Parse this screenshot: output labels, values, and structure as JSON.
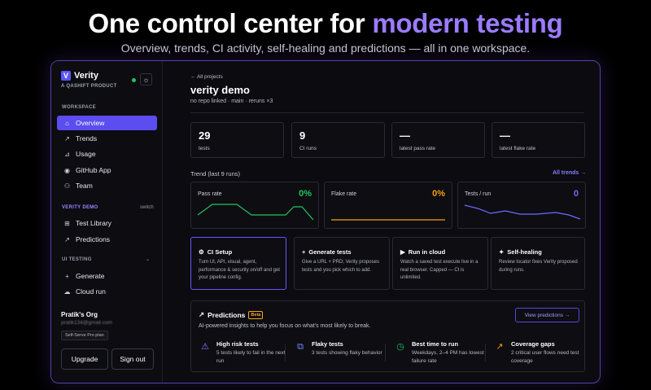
{
  "hero": {
    "title_main": "One control center for ",
    "title_accent": "modern testing",
    "subtitle": "Overview, trends, CI activity, self-healing and predictions — all in one workspace."
  },
  "sidebar": {
    "brand_name": "Verity",
    "brand_tag": "A QASHIFT PRODUCT",
    "workspace_label": "WORKSPACE",
    "workspace_items": [
      {
        "label": "Overview",
        "icon": "home-icon"
      },
      {
        "label": "Trends",
        "icon": "trend-icon"
      },
      {
        "label": "Usage",
        "icon": "chart-icon"
      },
      {
        "label": "GitHub App",
        "icon": "github-icon"
      },
      {
        "label": "Team",
        "icon": "team-icon"
      }
    ],
    "project_label": "VERITY DEMO",
    "project_switch": "switch",
    "project_items": [
      {
        "label": "Test Library",
        "icon": "grid-icon"
      },
      {
        "label": "Predictions",
        "icon": "trend-icon"
      }
    ],
    "testing_label": "UI TESTING",
    "testing_items": [
      {
        "label": "Generate",
        "icon": "plus-icon"
      },
      {
        "label": "Cloud run",
        "icon": "cloud-icon"
      }
    ],
    "org_name": "Pratik's Org",
    "org_email": "pratik134@gmail.com",
    "plan": "Self-Serve Pro plan",
    "upgrade_label": "Upgrade",
    "signout_label": "Sign out"
  },
  "main": {
    "back_link": "← All projects",
    "project_title": "verity demo",
    "project_meta": "no repo linked · main · reruns ×3",
    "stats": [
      {
        "value": "29",
        "label": "tests"
      },
      {
        "value": "9",
        "label": "CI runs"
      },
      {
        "value": "—",
        "label": "latest pass rate"
      },
      {
        "value": "—",
        "label": "latest flake rate"
      }
    ],
    "trend_label": "Trend (last 9 runs)",
    "trend_link": "All trends →",
    "trends": [
      {
        "title": "Pass rate",
        "value": "0%",
        "color": "#22c55e"
      },
      {
        "title": "Flake rate",
        "value": "0%",
        "color": "#f59e0b"
      },
      {
        "title": "Tests / run",
        "value": "0",
        "color": "#6d6bff"
      }
    ],
    "features": [
      {
        "title": "CI Setup",
        "icon": "gear-icon",
        "body": "Turn UI, API, visual, agent, performance & security on/off and get your pipeline config."
      },
      {
        "title": "Generate tests",
        "icon": "plus-icon",
        "body": "Give a URL + PRD; Verity proposes tests and you pick which to add."
      },
      {
        "title": "Run in cloud",
        "icon": "play-icon",
        "body": "Watch a saved test execute live in a real browser. Capped — CI is unlimited."
      },
      {
        "title": "Self-healing",
        "icon": "wand-icon",
        "body": "Review locator fixes Verity proposed during runs."
      }
    ],
    "predictions": {
      "title": "Predictions",
      "badge": "Beta",
      "subtitle": "AI-powered insights to help you focus on what's most likely to break.",
      "button": "View predictions →",
      "items": [
        {
          "title": "High risk tests",
          "desc": "5 tests likely to fail in the next run",
          "icon": "warning-icon",
          "color": "#8b7bff"
        },
        {
          "title": "Flaky tests",
          "desc": "3 tests showing flaky behavior",
          "icon": "flaky-icon",
          "color": "#7b8cff"
        },
        {
          "title": "Best time to run",
          "desc": "Weekdays, 2–4 PM has lowest failure rate",
          "icon": "clock-icon",
          "color": "#22c55e"
        },
        {
          "title": "Coverage gaps",
          "desc": "2 critical user flows need test coverage",
          "icon": "trend-up-icon",
          "color": "#f59e0b"
        }
      ]
    }
  }
}
